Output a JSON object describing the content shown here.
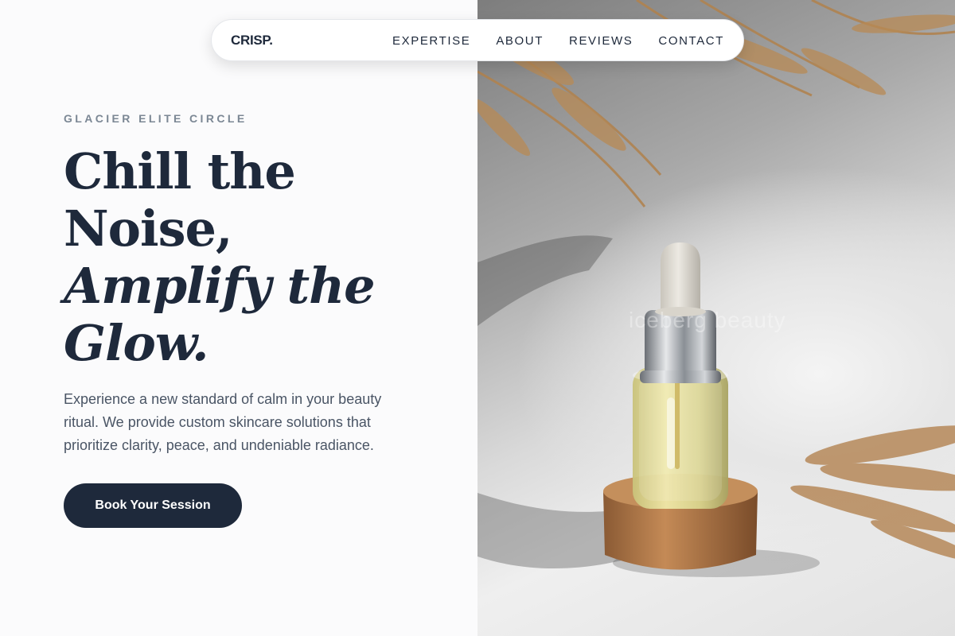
{
  "nav": {
    "logo": "CRISP.",
    "links": [
      "EXPERTISE",
      "ABOUT",
      "REVIEWS",
      "CONTACT"
    ]
  },
  "hero": {
    "eyebrow": "GLACIER ELITE CIRCLE",
    "headline_line1": "Chill the",
    "headline_line2": "Noise,",
    "headline_line3": "Amplify the",
    "headline_line4": "Glow.",
    "description": "Experience a new standard of calm in your beauty ritual. We provide custom skincare solutions that prioritize clarity, peace, and undeniable radiance.",
    "cta_label": "Book Your Session"
  },
  "image": {
    "watermark": "iceberg beauty",
    "subject": "serum-dropper-bottle-on-cork"
  },
  "colors": {
    "navy": "#1e293b",
    "muted": "#7b8794",
    "background": "#fbfbfc"
  }
}
